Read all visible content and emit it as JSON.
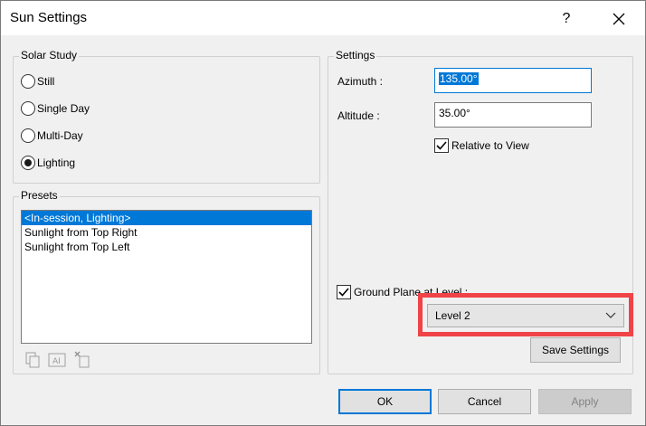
{
  "window": {
    "title": "Sun Settings",
    "help_label": "?"
  },
  "solar_study": {
    "legend": "Solar Study",
    "options": [
      {
        "label": "Still",
        "selected": false
      },
      {
        "label": "Single Day",
        "selected": false
      },
      {
        "label": "Multi-Day",
        "selected": false
      },
      {
        "label": "Lighting",
        "selected": true
      }
    ]
  },
  "presets": {
    "legend": "Presets",
    "items": [
      {
        "label": "<In-session, Lighting>",
        "selected": true
      },
      {
        "label": "Sunlight from Top Right",
        "selected": false
      },
      {
        "label": "Sunlight from Top Left",
        "selected": false
      }
    ],
    "toolbar_icons": [
      "duplicate-icon",
      "rename-icon",
      "delete-icon"
    ],
    "rename_icon_text": "AI"
  },
  "settings": {
    "legend": "Settings",
    "azimuth_label": "Azimuth :",
    "azimuth_value": "135.00°",
    "altitude_label": "Altitude :",
    "altitude_value": "35.00°",
    "relative_to_view_label": "Relative to View",
    "relative_to_view_checked": true,
    "ground_plane_label": "Ground Plane at Level :",
    "ground_plane_checked": true,
    "level_value": "Level 2",
    "save_settings_label": "Save Settings"
  },
  "buttons": {
    "ok": "OK",
    "cancel": "Cancel",
    "apply": "Apply"
  },
  "colors": {
    "accent": "#0078d7",
    "highlight_box": "#ef4347"
  }
}
